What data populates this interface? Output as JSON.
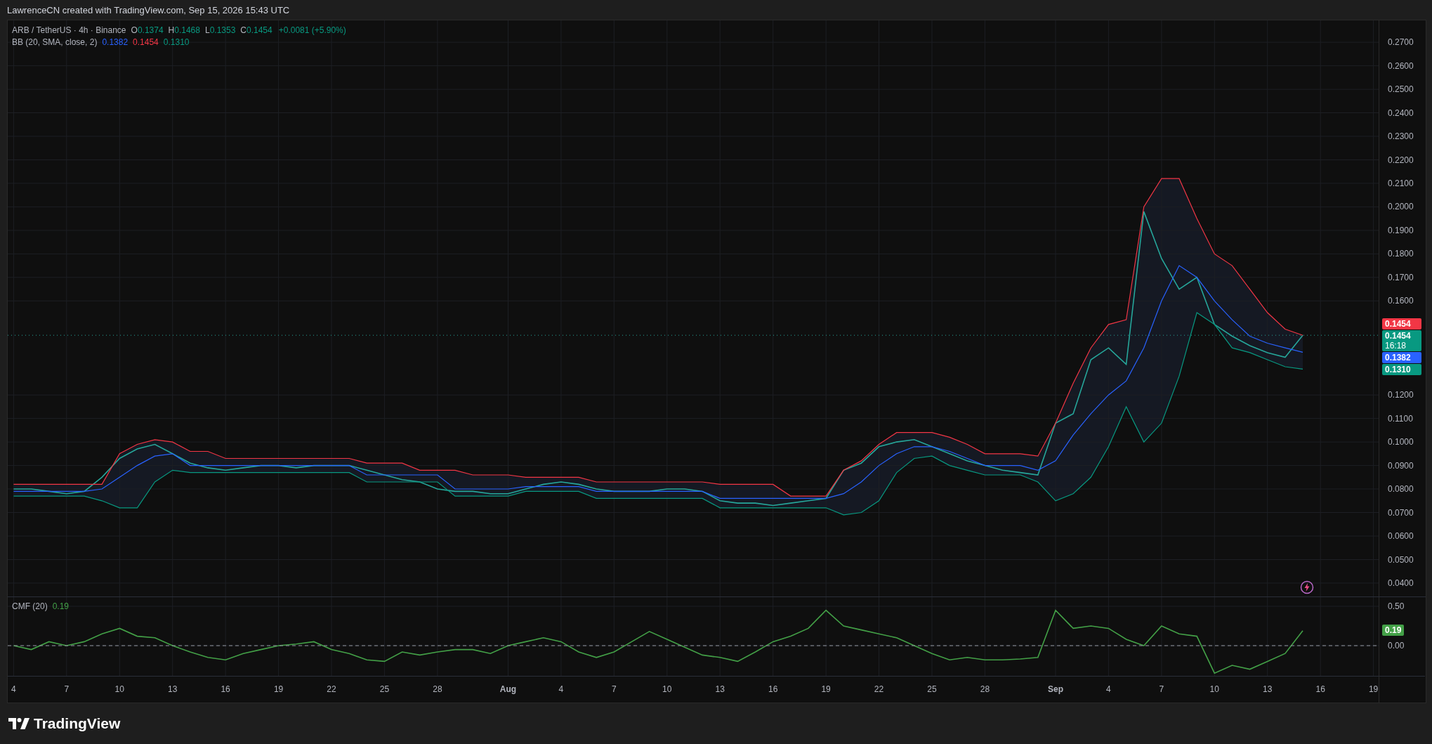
{
  "header": {
    "text": "LawrenceCN created with TradingView.com, Sep 15, 2026 15:43 UTC"
  },
  "main_pane": {
    "legend": {
      "symbol": "ARB / TetherUS · 4h · Binance",
      "ohlc": [
        {
          "key": "O",
          "value": "0.1374"
        },
        {
          "key": "H",
          "value": "0.1468"
        },
        {
          "key": "L",
          "value": "0.1353"
        },
        {
          "key": "C",
          "value": "0.1454"
        }
      ],
      "change": "+0.0081 (+5.90%)",
      "indicator": "BB (20, SMA, close, 2)",
      "indicator_values": [
        {
          "text": "0.1382",
          "color": "#2962ff"
        },
        {
          "text": "0.1454",
          "color": "#f23645"
        },
        {
          "text": "0.1310",
          "color": "#089981"
        }
      ]
    },
    "price_badges": [
      {
        "text": "0.1454",
        "color": "#f23645"
      },
      {
        "text": "0.1454",
        "countdown": "16:18",
        "color": "#089981"
      },
      {
        "text": "0.1382",
        "color": "#2962ff"
      },
      {
        "text": "0.1310",
        "color": "#089981"
      }
    ],
    "chart_data": {
      "type": "line",
      "grid": true,
      "xlim": [
        "2026-07-03T16:00:00Z",
        "2026-09-21T23:00:00Z"
      ],
      "ylim": [
        0.0343,
        0.2793
      ],
      "ref_lines": [
        {
          "axis": "y",
          "value": 0.1454
        }
      ],
      "x": [
        "2026-07-04",
        "2026-07-05",
        "2026-07-06",
        "2026-07-07",
        "2026-07-08",
        "2026-07-09",
        "2026-07-10",
        "2026-07-11",
        "2026-07-12",
        "2026-07-13",
        "2026-07-14",
        "2026-07-15",
        "2026-07-16",
        "2026-07-17",
        "2026-07-18",
        "2026-07-19",
        "2026-07-20",
        "2026-07-21",
        "2026-07-22",
        "2026-07-23",
        "2026-07-24",
        "2026-07-25",
        "2026-07-26",
        "2026-07-27",
        "2026-07-28",
        "2026-07-29",
        "2026-07-30",
        "2026-07-31",
        "2026-08-01",
        "2026-08-02",
        "2026-08-03",
        "2026-08-04",
        "2026-08-05",
        "2026-08-06",
        "2026-08-07",
        "2026-08-08",
        "2026-08-09",
        "2026-08-10",
        "2026-08-11",
        "2026-08-12",
        "2026-08-13",
        "2026-08-14",
        "2026-08-15",
        "2026-08-16",
        "2026-08-17",
        "2026-08-18",
        "2026-08-19",
        "2026-08-20",
        "2026-08-21",
        "2026-08-22",
        "2026-08-23",
        "2026-08-24",
        "2026-08-25",
        "2026-08-26",
        "2026-08-27",
        "2026-08-28",
        "2026-08-29",
        "2026-08-30",
        "2026-08-31",
        "2026-09-01",
        "2026-09-02",
        "2026-09-03",
        "2026-09-04",
        "2026-09-05",
        "2026-09-06",
        "2026-09-07",
        "2026-09-08",
        "2026-09-09",
        "2026-09-10",
        "2026-09-11",
        "2026-09-12",
        "2026-09-13",
        "2026-09-14",
        "2026-09-15"
      ],
      "yticks": [
        {
          "value": 0.04,
          "label": "0.0400"
        },
        {
          "value": 0.05,
          "label": "0.0500"
        },
        {
          "value": 0.06,
          "label": "0.0600"
        },
        {
          "value": 0.07,
          "label": "0.0700"
        },
        {
          "value": 0.08,
          "label": "0.0800"
        },
        {
          "value": 0.09,
          "label": "0.0900"
        },
        {
          "value": 0.1,
          "label": "0.1000"
        },
        {
          "value": 0.11,
          "label": "0.1100"
        },
        {
          "value": 0.12,
          "label": "0.1200"
        },
        {
          "value": 0.16,
          "label": "0.1600"
        },
        {
          "value": 0.17,
          "label": "0.1700"
        },
        {
          "value": 0.18,
          "label": "0.1800"
        },
        {
          "value": 0.19,
          "label": "0.1900"
        },
        {
          "value": 0.2,
          "label": "0.2000"
        },
        {
          "value": 0.21,
          "label": "0.2100"
        },
        {
          "value": 0.22,
          "label": "0.2200"
        },
        {
          "value": 0.23,
          "label": "0.2300"
        },
        {
          "value": 0.24,
          "label": "0.2400"
        },
        {
          "value": 0.25,
          "label": "0.2500"
        },
        {
          "value": 0.26,
          "label": "0.2600"
        },
        {
          "value": 0.27,
          "label": "0.2700"
        }
      ],
      "series": [
        {
          "color": "#26a69a",
          "values": [
            0.08,
            0.08,
            0.079,
            0.078,
            0.079,
            0.085,
            0.093,
            0.097,
            0.099,
            0.095,
            0.091,
            0.089,
            0.088,
            0.089,
            0.09,
            0.09,
            0.089,
            0.09,
            0.09,
            0.09,
            0.088,
            0.086,
            0.084,
            0.083,
            0.08,
            0.079,
            0.079,
            0.078,
            0.078,
            0.08,
            0.082,
            0.083,
            0.082,
            0.08,
            0.079,
            0.079,
            0.079,
            0.08,
            0.08,
            0.079,
            0.075,
            0.074,
            0.074,
            0.073,
            0.074,
            0.075,
            0.076,
            0.088,
            0.091,
            0.098,
            0.1,
            0.101,
            0.098,
            0.095,
            0.092,
            0.09,
            0.088,
            0.087,
            0.086,
            0.108,
            0.112,
            0.135,
            0.14,
            0.133,
            0.198,
            0.178,
            0.165,
            0.17,
            0.15,
            0.145,
            0.141,
            0.138,
            0.136,
            0.1454
          ]
        },
        {
          "color": "#f23645",
          "values": [
            0.082,
            0.082,
            0.082,
            0.082,
            0.082,
            0.082,
            0.095,
            0.099,
            0.101,
            0.1,
            0.096,
            0.096,
            0.093,
            0.093,
            0.093,
            0.093,
            0.093,
            0.093,
            0.093,
            0.093,
            0.091,
            0.091,
            0.091,
            0.088,
            0.088,
            0.088,
            0.086,
            0.086,
            0.086,
            0.085,
            0.085,
            0.085,
            0.085,
            0.083,
            0.083,
            0.083,
            0.083,
            0.083,
            0.083,
            0.083,
            0.082,
            0.082,
            0.082,
            0.082,
            0.077,
            0.077,
            0.077,
            0.088,
            0.092,
            0.099,
            0.104,
            0.104,
            0.104,
            0.102,
            0.099,
            0.095,
            0.095,
            0.095,
            0.094,
            0.108,
            0.125,
            0.14,
            0.15,
            0.152,
            0.2,
            0.212,
            0.212,
            0.195,
            0.18,
            0.175,
            0.165,
            0.155,
            0.148,
            0.1454
          ]
        },
        {
          "color": "#2962ff",
          "values": [
            0.079,
            0.079,
            0.079,
            0.079,
            0.079,
            0.08,
            0.085,
            0.09,
            0.094,
            0.095,
            0.09,
            0.09,
            0.09,
            0.09,
            0.09,
            0.09,
            0.09,
            0.09,
            0.09,
            0.09,
            0.086,
            0.086,
            0.086,
            0.086,
            0.086,
            0.08,
            0.08,
            0.08,
            0.08,
            0.081,
            0.081,
            0.081,
            0.081,
            0.079,
            0.079,
            0.079,
            0.079,
            0.079,
            0.079,
            0.079,
            0.076,
            0.076,
            0.076,
            0.076,
            0.076,
            0.076,
            0.076,
            0.078,
            0.083,
            0.09,
            0.095,
            0.098,
            0.098,
            0.096,
            0.093,
            0.09,
            0.09,
            0.09,
            0.088,
            0.092,
            0.103,
            0.112,
            0.12,
            0.126,
            0.14,
            0.16,
            0.175,
            0.17,
            0.16,
            0.152,
            0.145,
            0.142,
            0.14,
            0.1382
          ]
        },
        {
          "color": "#089981",
          "values": [
            0.077,
            0.077,
            0.077,
            0.077,
            0.077,
            0.075,
            0.072,
            0.072,
            0.083,
            0.088,
            0.087,
            0.087,
            0.087,
            0.087,
            0.087,
            0.087,
            0.087,
            0.087,
            0.087,
            0.087,
            0.083,
            0.083,
            0.083,
            0.083,
            0.083,
            0.077,
            0.077,
            0.077,
            0.077,
            0.079,
            0.079,
            0.079,
            0.079,
            0.076,
            0.076,
            0.076,
            0.076,
            0.076,
            0.076,
            0.076,
            0.072,
            0.072,
            0.072,
            0.072,
            0.072,
            0.072,
            0.072,
            0.069,
            0.07,
            0.075,
            0.087,
            0.093,
            0.094,
            0.09,
            0.088,
            0.086,
            0.086,
            0.086,
            0.083,
            0.075,
            0.078,
            0.085,
            0.098,
            0.115,
            0.1,
            0.108,
            0.128,
            0.155,
            0.15,
            0.14,
            0.138,
            0.135,
            0.132,
            0.131
          ]
        }
      ]
    }
  },
  "cmf_pane": {
    "legend": {
      "indicator": "CMF (20)",
      "value": "0.19"
    },
    "value_badge": {
      "text": "0.19",
      "color": "#43a047"
    },
    "chart_data": {
      "type": "line",
      "grid": true,
      "xlim": [
        "2026-07-03T16:00:00Z",
        "2026-09-21T23:00:00Z"
      ],
      "ylim": [
        -0.384,
        0.616
      ],
      "ref_lines": [
        {
          "axis": "y",
          "value": 0
        }
      ],
      "x": [
        "2026-07-04",
        "2026-07-05",
        "2026-07-06",
        "2026-07-07",
        "2026-07-08",
        "2026-07-09",
        "2026-07-10",
        "2026-07-11",
        "2026-07-12",
        "2026-07-13",
        "2026-07-14",
        "2026-07-15",
        "2026-07-16",
        "2026-07-17",
        "2026-07-18",
        "2026-07-19",
        "2026-07-20",
        "2026-07-21",
        "2026-07-22",
        "2026-07-23",
        "2026-07-24",
        "2026-07-25",
        "2026-07-26",
        "2026-07-27",
        "2026-07-28",
        "2026-07-29",
        "2026-07-30",
        "2026-07-31",
        "2026-08-01",
        "2026-08-02",
        "2026-08-03",
        "2026-08-04",
        "2026-08-05",
        "2026-08-06",
        "2026-08-07",
        "2026-08-08",
        "2026-08-09",
        "2026-08-10",
        "2026-08-11",
        "2026-08-12",
        "2026-08-13",
        "2026-08-14",
        "2026-08-15",
        "2026-08-16",
        "2026-08-17",
        "2026-08-18",
        "2026-08-19",
        "2026-08-20",
        "2026-08-21",
        "2026-08-22",
        "2026-08-23",
        "2026-08-24",
        "2026-08-25",
        "2026-08-26",
        "2026-08-27",
        "2026-08-28",
        "2026-08-29",
        "2026-08-30",
        "2026-08-31",
        "2026-09-01",
        "2026-09-02",
        "2026-09-03",
        "2026-09-04",
        "2026-09-05",
        "2026-09-06",
        "2026-09-07",
        "2026-09-08",
        "2026-09-09",
        "2026-09-10",
        "2026-09-11",
        "2026-09-12",
        "2026-09-13",
        "2026-09-14",
        "2026-09-15"
      ],
      "xticks": [
        {
          "value": "2026-07-04",
          "label": "4"
        },
        {
          "value": "2026-07-07",
          "label": "7"
        },
        {
          "value": "2026-07-10",
          "label": "10"
        },
        {
          "value": "2026-07-13",
          "label": "13"
        },
        {
          "value": "2026-07-16",
          "label": "16"
        },
        {
          "value": "2026-07-19",
          "label": "19"
        },
        {
          "value": "2026-07-22",
          "label": "22"
        },
        {
          "value": "2026-07-25",
          "label": "25"
        },
        {
          "value": "2026-07-28",
          "label": "28"
        },
        {
          "value": "2026-08-01",
          "label": "Aug"
        },
        {
          "value": "2026-08-04",
          "label": "4"
        },
        {
          "value": "2026-08-07",
          "label": "7"
        },
        {
          "value": "2026-08-10",
          "label": "10"
        },
        {
          "value": "2026-08-13",
          "label": "13"
        },
        {
          "value": "2026-08-16",
          "label": "16"
        },
        {
          "value": "2026-08-19",
          "label": "19"
        },
        {
          "value": "2026-08-22",
          "label": "22"
        },
        {
          "value": "2026-08-25",
          "label": "25"
        },
        {
          "value": "2026-08-28",
          "label": "28"
        },
        {
          "value": "2026-09-01",
          "label": "Sep"
        },
        {
          "value": "2026-09-04",
          "label": "4"
        },
        {
          "value": "2026-09-07",
          "label": "7"
        },
        {
          "value": "2026-09-10",
          "label": "10"
        },
        {
          "value": "2026-09-13",
          "label": "13"
        },
        {
          "value": "2026-09-16",
          "label": "16"
        },
        {
          "value": "2026-09-19",
          "label": "19"
        }
      ],
      "yticks": [
        {
          "value": 0.5,
          "label": "0.50"
        },
        {
          "value": 0,
          "label": "0.00"
        }
      ],
      "series": [
        {
          "color": "#43a047",
          "values": [
            0.0,
            -0.05,
            0.05,
            0.0,
            0.05,
            0.15,
            0.22,
            0.12,
            0.1,
            0.0,
            -0.08,
            -0.15,
            -0.18,
            -0.1,
            -0.05,
            0.0,
            0.02,
            0.05,
            -0.05,
            -0.1,
            -0.18,
            -0.2,
            -0.08,
            -0.12,
            -0.08,
            -0.05,
            -0.05,
            -0.1,
            0.0,
            0.05,
            0.1,
            0.05,
            -0.08,
            -0.15,
            -0.08,
            0.05,
            0.18,
            0.08,
            -0.02,
            -0.12,
            -0.15,
            -0.2,
            -0.08,
            0.05,
            0.12,
            0.22,
            0.45,
            0.25,
            0.2,
            0.15,
            0.1,
            0.0,
            -0.1,
            -0.18,
            -0.15,
            -0.18,
            -0.18,
            -0.17,
            -0.15,
            0.45,
            0.22,
            0.25,
            0.22,
            0.08,
            0.0,
            0.25,
            0.15,
            0.12,
            -0.35,
            -0.25,
            -0.3,
            -0.2,
            -0.1,
            0.19
          ]
        }
      ]
    }
  },
  "footer": {
    "brand": "TradingView"
  }
}
